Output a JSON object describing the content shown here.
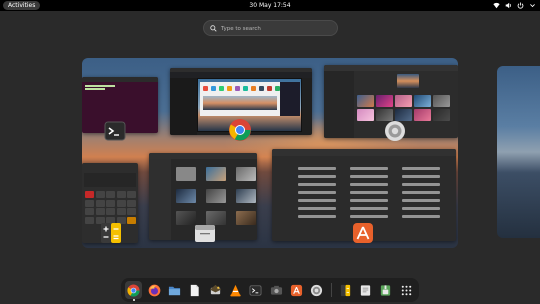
{
  "topbar": {
    "activities": "Activities",
    "clock": "30 May  17:54",
    "status_icons": [
      "network-icon",
      "volume-icon",
      "power-icon",
      "chevron-down-icon"
    ]
  },
  "search": {
    "placeholder": "Type to search"
  },
  "workspace": {
    "windows": [
      "terminal",
      "chrome",
      "wallpaper-settings",
      "calculator",
      "files",
      "software"
    ]
  },
  "dash": {
    "items": [
      {
        "name": "chrome",
        "active": true
      },
      {
        "name": "firefox",
        "active": false
      },
      {
        "name": "files-folder",
        "active": false
      },
      {
        "name": "text-document",
        "active": false
      },
      {
        "name": "thunderbird",
        "active": false
      },
      {
        "name": "vlc",
        "active": false
      },
      {
        "name": "terminal",
        "active": false
      },
      {
        "name": "screenshot",
        "active": false
      },
      {
        "name": "software",
        "active": false
      },
      {
        "name": "settings",
        "active": false
      },
      {
        "name": "calculator",
        "active": false
      },
      {
        "name": "text-editor",
        "active": false
      },
      {
        "name": "archive",
        "active": false
      },
      {
        "name": "app-grid",
        "active": false
      }
    ]
  },
  "colors": {
    "topbar": "#000000",
    "background": "#2a2a2a",
    "dash": "#1f1f1f",
    "software_accent": "#e8612b",
    "calc_accent": "#f5c000"
  }
}
